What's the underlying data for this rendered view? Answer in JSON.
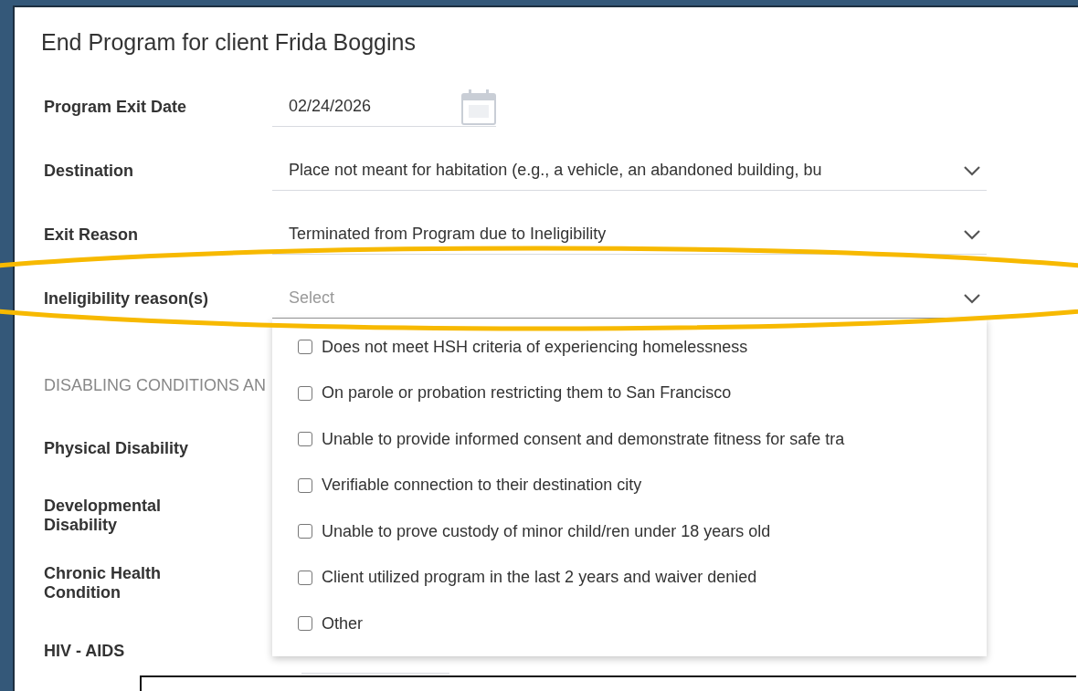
{
  "dialog": {
    "title": "End Program for client Frida Boggins"
  },
  "fields": [
    {
      "label": "Program Exit Date",
      "kind": "date",
      "value": "02/24/2026"
    },
    {
      "label": "Destination",
      "kind": "select",
      "value": "Place not meant for habitation (e.g., a vehicle, an abandoned building, bu"
    },
    {
      "label": "Exit Reason",
      "kind": "select",
      "value": "Terminated from Program due to Ineligibility"
    },
    {
      "label": "Ineligibility reason(s)",
      "kind": "select",
      "placeholder": "Select",
      "expanded": true,
      "options": [
        {
          "label": "Does not meet HSH criteria of experiencing homelessness",
          "checked": false
        },
        {
          "label": "On parole or probation restricting them to San Francisco",
          "checked": false
        },
        {
          "label": "Unable to provide informed consent and demonstrate fitness for safe tra",
          "checked": false
        },
        {
          "label": "Verifiable connection to their destination city",
          "checked": false
        },
        {
          "label": "Unable to prove custody of minor child/ren under 18 years old",
          "checked": false
        },
        {
          "label": "Client utilized program in the last 2 years and waiver denied",
          "checked": false
        },
        {
          "label": "Other",
          "checked": false
        }
      ]
    }
  ],
  "section": {
    "heading": "DISABLING CONDITIONS AN",
    "fields": [
      {
        "label": "Physical Disability"
      },
      {
        "label": "Developmental Disability"
      },
      {
        "label": "Chronic Health Condition"
      },
      {
        "label": "HIV - AIDS"
      }
    ]
  }
}
